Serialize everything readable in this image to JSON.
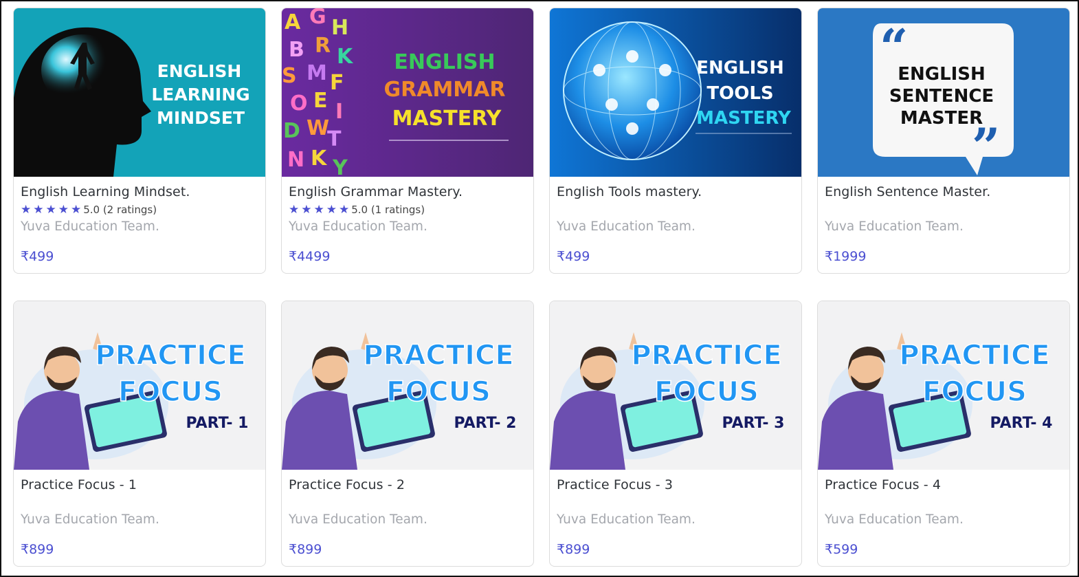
{
  "currency_symbol": "₹",
  "courses": [
    {
      "title": "English Learning Mindset.",
      "rating": 5.0,
      "stars": "★★★★★",
      "rating_text": "5.0 (2 ratings)",
      "author": "Yuva Education Team.",
      "price": "₹499",
      "thumb_lines": [
        "ENGLISH",
        "LEARNING",
        "MINDSET"
      ],
      "thumb_bg": "#13a3b8"
    },
    {
      "title": "English Grammar Mastery.",
      "rating": 5.0,
      "stars": "★★★★★",
      "rating_text": "5.0 (1 ratings)",
      "author": "Yuva Education Team.",
      "price": "₹4499",
      "thumb_lines": [
        "ENGLISH",
        "GRAMMAR",
        "MASTERY"
      ],
      "thumb_bg": "#5e2a86"
    },
    {
      "title": "English Tools mastery.",
      "rating": null,
      "stars": "",
      "rating_text": "",
      "author": "Yuva Education Team.",
      "price": "₹499",
      "thumb_lines": [
        "ENGLISH",
        "TOOLS",
        "MASTERY"
      ],
      "thumb_bg": "#0d3f86"
    },
    {
      "title": "English Sentence Master.",
      "rating": null,
      "stars": "",
      "rating_text": "",
      "author": "Yuva Education Team.",
      "price": "₹1999",
      "thumb_lines": [
        "ENGLISH",
        "SENTENCE",
        "MASTER"
      ],
      "thumb_bg": "#2b78c4"
    },
    {
      "title": "Practice Focus - 1",
      "rating": null,
      "stars": "",
      "rating_text": "",
      "author": "Yuva Education Team.",
      "price": "₹899",
      "thumb_lines": [
        "PRACTICE",
        "FOCUS",
        "PART- 1"
      ],
      "thumb_bg": "#f2f2f3"
    },
    {
      "title": "Practice Focus - 2",
      "rating": null,
      "stars": "",
      "rating_text": "",
      "author": "Yuva Education Team.",
      "price": "₹899",
      "thumb_lines": [
        "PRACTICE",
        "FOCUS",
        "PART- 2"
      ],
      "thumb_bg": "#f2f2f3"
    },
    {
      "title": "Practice Focus - 3",
      "rating": null,
      "stars": "",
      "rating_text": "",
      "author": "Yuva Education Team.",
      "price": "₹899",
      "thumb_lines": [
        "PRACTICE",
        "FOCUS",
        "PART- 3"
      ],
      "thumb_bg": "#f2f2f3"
    },
    {
      "title": "Practice Focus - 4",
      "rating": null,
      "stars": "",
      "rating_text": "",
      "author": "Yuva Education Team.",
      "price": "₹599",
      "thumb_lines": [
        "PRACTICE",
        "FOCUS",
        "PART- 4"
      ],
      "thumb_bg": "#f2f2f3"
    }
  ],
  "colors": {
    "accent": "#4b4fd1",
    "author": "#a4a7ad",
    "title": "#2f3338"
  }
}
